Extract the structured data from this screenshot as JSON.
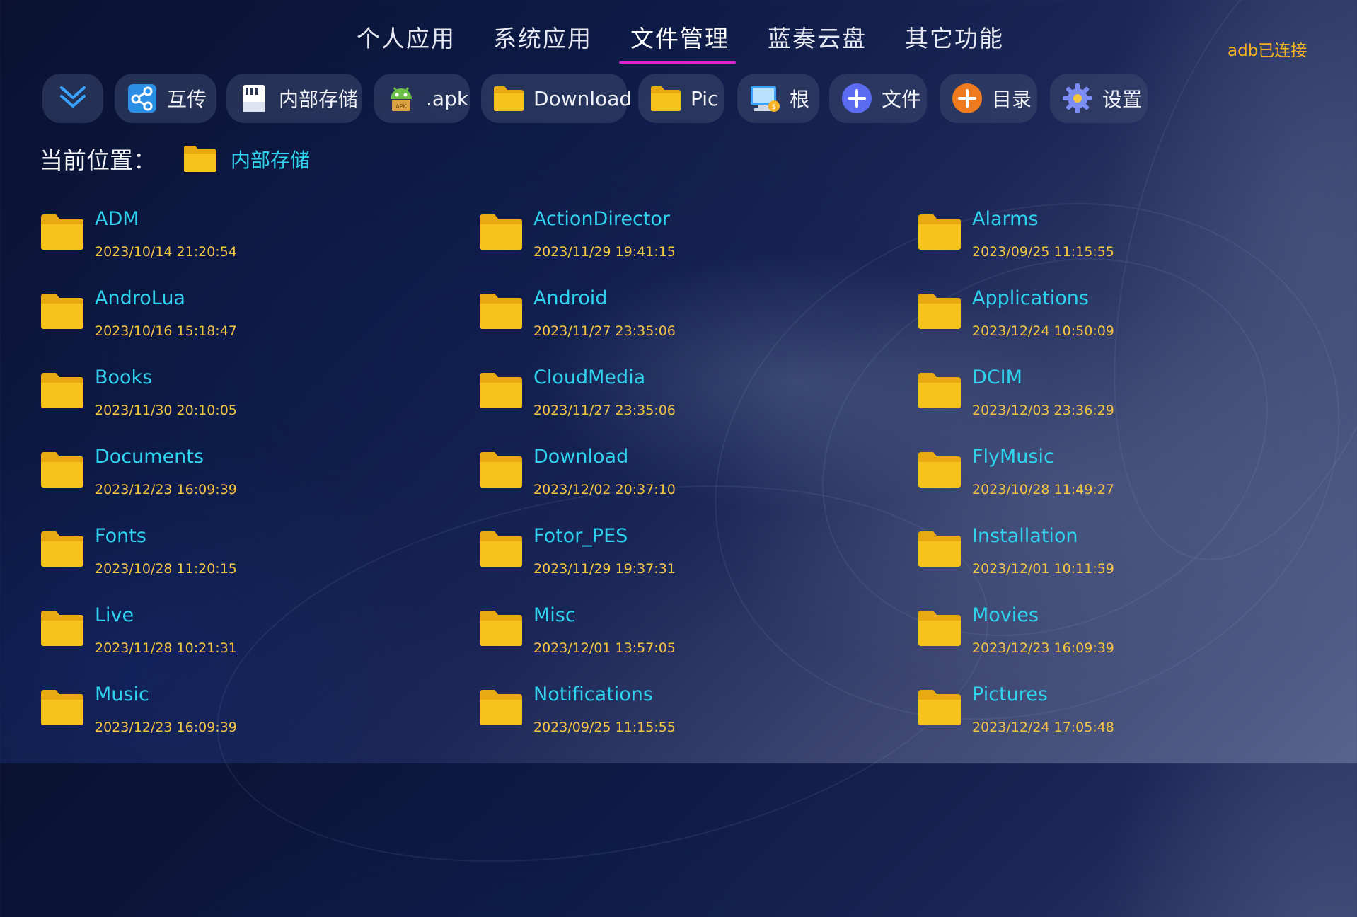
{
  "tabs": [
    {
      "label": "个人应用"
    },
    {
      "label": "系统应用"
    },
    {
      "label": "文件管理"
    },
    {
      "label": "蓝奏云盘"
    },
    {
      "label": "其它功能"
    }
  ],
  "active_tab": "文件管理",
  "status": {
    "adb": "adb已连接"
  },
  "toolbar": {
    "expand_icon": "chevron-double-down-icon",
    "buttons": [
      {
        "label": "互传",
        "icon": "share-icon"
      },
      {
        "label": "内部存储",
        "icon": "storage-icon"
      },
      {
        "label": ".apk",
        "icon": "android-apk-icon"
      },
      {
        "label": "Download",
        "icon": "folder-icon"
      },
      {
        "label": "Pic",
        "icon": "folder-icon"
      },
      {
        "label": "根",
        "icon": "root-computer-icon"
      },
      {
        "label": "文件",
        "icon": "plus-icon"
      },
      {
        "label": "目录",
        "icon": "plus-icon"
      },
      {
        "label": "设置",
        "icon": "gear-icon"
      }
    ]
  },
  "breadcrumb": {
    "title": "当前位置：",
    "current": "内部存储"
  },
  "colors": {
    "accent": "#d926d0",
    "name": "#2fd3ee",
    "date": "#f5c542",
    "adb": "#f5b323",
    "folder": "#f8c21c"
  },
  "files": [
    {
      "name": "ADM",
      "date": "2023/10/14 21:20:54"
    },
    {
      "name": "ActionDirector",
      "date": "2023/11/29 19:41:15"
    },
    {
      "name": "Alarms",
      "date": "2023/09/25 11:15:55"
    },
    {
      "name": "AndroLua",
      "date": "2023/10/16 15:18:47"
    },
    {
      "name": "Android",
      "date": "2023/11/27 23:35:06"
    },
    {
      "name": "Applications",
      "date": "2023/12/24 10:50:09"
    },
    {
      "name": "Books",
      "date": "2023/11/30 20:10:05"
    },
    {
      "name": "CloudMedia",
      "date": "2023/11/27 23:35:06"
    },
    {
      "name": "DCIM",
      "date": "2023/12/03 23:36:29"
    },
    {
      "name": "Documents",
      "date": "2023/12/23 16:09:39"
    },
    {
      "name": "Download",
      "date": "2023/12/02 20:37:10"
    },
    {
      "name": "FlyMusic",
      "date": "2023/10/28 11:49:27"
    },
    {
      "name": "Fonts",
      "date": "2023/10/28 11:20:15"
    },
    {
      "name": "Fotor_PES",
      "date": "2023/11/29 19:37:31"
    },
    {
      "name": "Installation",
      "date": "2023/12/01 10:11:59"
    },
    {
      "name": "Live",
      "date": "2023/11/28 10:21:31"
    },
    {
      "name": "Misc",
      "date": "2023/12/01 13:57:05"
    },
    {
      "name": "Movies",
      "date": "2023/12/23 16:09:39"
    },
    {
      "name": "Music",
      "date": "2023/12/23 16:09:39"
    },
    {
      "name": "Notifications",
      "date": "2023/09/25 11:15:55"
    },
    {
      "name": "Pictures",
      "date": "2023/12/24 17:05:48"
    }
  ]
}
